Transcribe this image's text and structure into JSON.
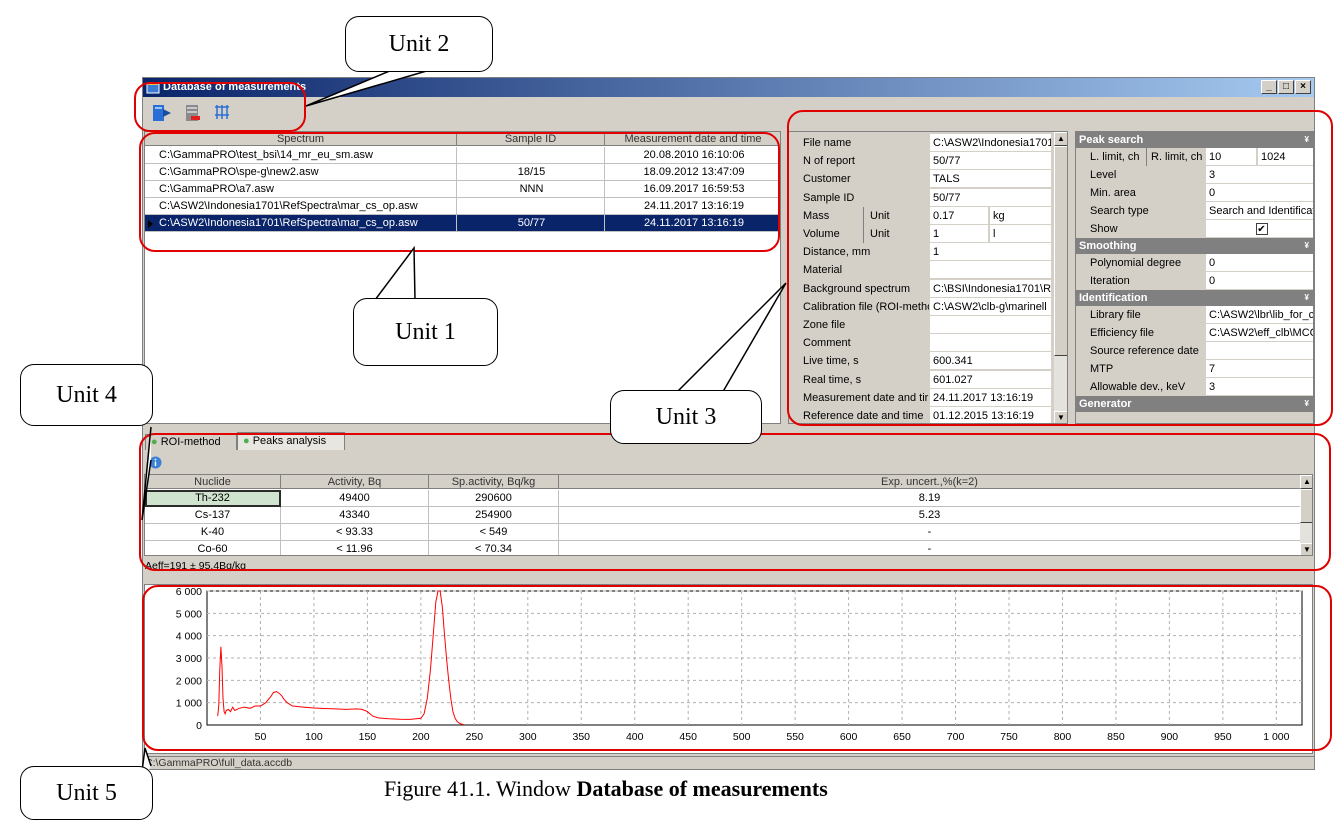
{
  "window": {
    "title": "Database of measurements",
    "buttons": [
      "_",
      "□",
      "×"
    ]
  },
  "toolbar": {
    "icons": [
      "open-database-icon",
      "delete-record-icon",
      "filter-icon"
    ]
  },
  "measurements": {
    "columns": [
      "Spectrum",
      "Sample ID",
      "Measurement date and time"
    ],
    "rows": [
      [
        "C:\\GammaPRO\\test_bsi\\14_mr_eu_sm.asw",
        "",
        "20.08.2010 16:10:06"
      ],
      [
        "C:\\GammaPRO\\spe-g\\new2.asw",
        "18/15",
        "18.09.2012 13:47:09"
      ],
      [
        "C:\\GammaPRO\\a7.asw",
        "NNN",
        "16.09.2017 16:59:53"
      ],
      [
        "C:\\ASW2\\Indonesia1701\\RefSpectra\\mar_cs_op.asw",
        "",
        "24.11.2017 13:16:19"
      ],
      [
        "C:\\ASW2\\Indonesia1701\\RefSpectra\\mar_cs_op.asw",
        "50/77",
        "24.11.2017 13:16:19"
      ]
    ],
    "selected_row": 4
  },
  "properties": {
    "rows": [
      {
        "label": "File name",
        "value": "C:\\ASW2\\Indonesia1701"
      },
      {
        "label": "N of report",
        "value": "50/77"
      },
      {
        "label": "Customer",
        "value": "TALS"
      },
      {
        "label": "Sample ID",
        "value": "50/77"
      },
      {
        "label": "Mass",
        "label2": "Unit",
        "value": "0.17",
        "value2": "kg"
      },
      {
        "label": "Volume",
        "label2": "Unit",
        "value": "1",
        "value2": "l"
      },
      {
        "label": "Distance, mm",
        "value": "1"
      },
      {
        "label": "Material",
        "value": ""
      },
      {
        "label": "Background spectrum",
        "value": "C:\\BSI\\Indonesia1701\\R"
      },
      {
        "label": "Calibration file (ROI-metho",
        "value": "C:\\ASW2\\clb-g\\marinell"
      },
      {
        "label": "Zone file",
        "value": ""
      },
      {
        "label": "Comment",
        "value": ""
      },
      {
        "label": "Live time, s",
        "value": "600.341"
      },
      {
        "label": "Real time, s",
        "value": "601.027"
      },
      {
        "label": "Measurement date and tir",
        "value": "24.11.2017 13:16:19"
      },
      {
        "label": "Reference date and time",
        "value": "01.12.2015 13:16:19"
      }
    ]
  },
  "settings": {
    "peak_search": {
      "title": "Peak search",
      "rows": [
        {
          "label": "L. limit, ch",
          "label2": "R. limit, ch",
          "value": "10",
          "value2": "1024"
        },
        {
          "label": "Level",
          "value": "3"
        },
        {
          "label": "Min. area",
          "value": "0"
        },
        {
          "label": "Search type",
          "value": "Search and Identificatic"
        },
        {
          "label": "Show",
          "value": "✔"
        }
      ]
    },
    "smoothing": {
      "title": "Smoothing",
      "rows": [
        {
          "label": "Polynomial degree",
          "value": "0"
        },
        {
          "label": "Iteration",
          "value": "0"
        }
      ]
    },
    "identification": {
      "title": "Identification",
      "rows": [
        {
          "label": "Library file",
          "value": "C:\\ASW2\\lbr\\lib_for_clb"
        },
        {
          "label": "Efficiency file",
          "value": "C:\\ASW2\\eff_clb\\MCC_"
        },
        {
          "label": "Source reference date",
          "value": ""
        },
        {
          "label": "MTP",
          "value": "7"
        },
        {
          "label": "Allowable dev., keV",
          "value": "3"
        }
      ]
    },
    "generator": {
      "title": "Generator"
    }
  },
  "tabs": [
    {
      "label": "ROI-method",
      "active": false
    },
    {
      "label": "Peaks analysis",
      "active": true
    }
  ],
  "results": {
    "columns": [
      "Nuclide",
      "Activity, Bq",
      "Sp.activity, Bq/kg",
      "Exp. uncert.,%(k=2)"
    ],
    "rows": [
      [
        "Th-232",
        "49400",
        "290600",
        "8.19"
      ],
      [
        "Cs-137",
        "43340",
        "254900",
        "5.23"
      ],
      [
        "K-40",
        "< 93.33",
        "< 549",
        "-"
      ],
      [
        "Co-60",
        "< 11.96",
        "< 70.34",
        "-"
      ]
    ],
    "summary": "Aeff=191 ± 95.4Bq/kg"
  },
  "chart_data": {
    "type": "line",
    "title": "",
    "xlabel": "",
    "ylabel": "",
    "xlim": [
      0,
      1024
    ],
    "ylim": [
      0,
      6000
    ],
    "x_ticks": [
      "50",
      "100",
      "150",
      "200",
      "250",
      "300",
      "350",
      "400",
      "450",
      "500",
      "550",
      "600",
      "650",
      "700",
      "750",
      "800",
      "850",
      "900",
      "950",
      "1 000"
    ],
    "y_ticks": [
      "0",
      "1 000",
      "2 000",
      "3 000",
      "4 000",
      "5 000",
      "6 000"
    ],
    "grid": true,
    "series": [
      {
        "color": "#ff0000",
        "x": [
          10,
          11,
          12,
          13,
          14,
          15,
          16,
          17,
          18,
          20,
          22,
          24,
          26,
          28,
          30,
          35,
          40,
          45,
          50,
          55,
          60,
          62,
          65,
          68,
          70,
          72,
          75,
          80,
          90,
          100,
          110,
          120,
          130,
          140,
          145,
          150,
          155,
          160,
          170,
          180,
          190,
          200,
          203,
          206,
          209,
          212,
          214,
          216,
          218,
          220,
          222,
          224,
          226,
          228,
          230,
          232,
          234,
          236,
          238,
          240
        ],
        "y": [
          400,
          900,
          2500,
          3500,
          2600,
          1200,
          600,
          500,
          650,
          700,
          600,
          800,
          650,
          700,
          750,
          800,
          750,
          850,
          850,
          1000,
          1300,
          1450,
          1500,
          1400,
          1300,
          1150,
          1000,
          850,
          800,
          760,
          740,
          720,
          700,
          720,
          700,
          600,
          400,
          320,
          280,
          260,
          250,
          300,
          500,
          1200,
          2500,
          4300,
          5500,
          6000,
          6000,
          5300,
          4100,
          3000,
          2000,
          1200,
          600,
          300,
          150,
          80,
          40,
          20
        ]
      }
    ]
  },
  "status": {
    "path": "C:\\GammaPRO\\full_data.accdb"
  },
  "figure": {
    "caption_prefix": "Figure 41.1. Window ",
    "caption_bold": "Database of measurements"
  },
  "callouts": {
    "unit1": "Unit 1",
    "unit2": "Unit 2",
    "unit3": "Unit 3",
    "unit4": "Unit 4",
    "unit5": "Unit 5"
  }
}
